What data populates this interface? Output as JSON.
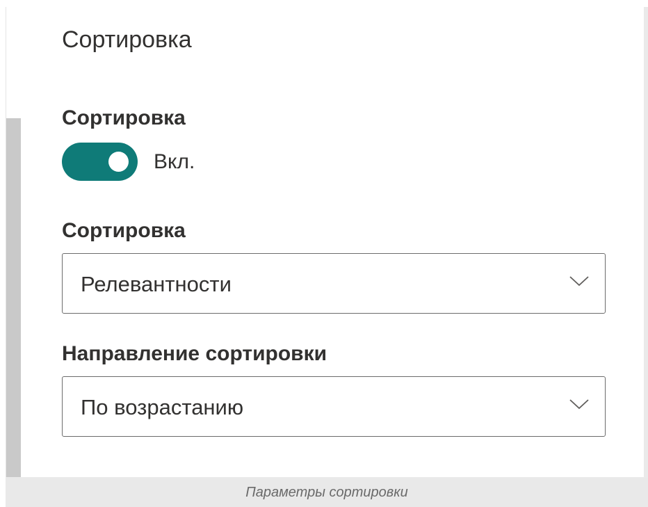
{
  "panel": {
    "title": "Сортировка"
  },
  "sort_toggle": {
    "label": "Сортировка",
    "state_text": "Вкл.",
    "on": true,
    "color": "#0f7b78"
  },
  "sort_by": {
    "label": "Сортировка",
    "selected": "Релевантности",
    "icon": "chevron-down-icon"
  },
  "sort_direction": {
    "label": "Направление сортировки",
    "selected": "По возрастанию",
    "icon": "chevron-down-icon"
  },
  "caption": "Параметры сортировки"
}
